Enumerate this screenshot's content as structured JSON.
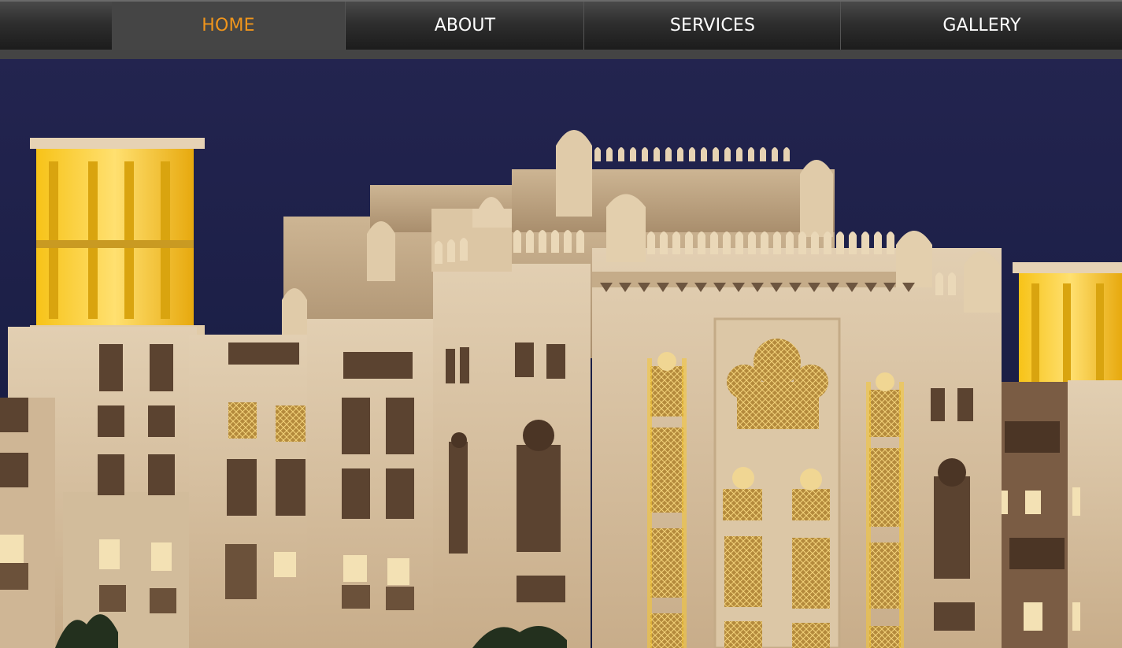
{
  "nav": {
    "items": [
      {
        "label": "HOME",
        "active": true
      },
      {
        "label": "ABOUT",
        "active": false
      },
      {
        "label": "SERVICES",
        "active": false
      },
      {
        "label": "GALLERY",
        "active": false
      }
    ],
    "colors": {
      "bar": "#444444",
      "active_text": "#f0951c",
      "text": "#ffffff"
    }
  },
  "hero": {
    "image": "night-palace-building-photo",
    "colors": {
      "sky": "#1f2350",
      "stone": "#d9c4a6",
      "glow": "#f5c21a"
    }
  }
}
